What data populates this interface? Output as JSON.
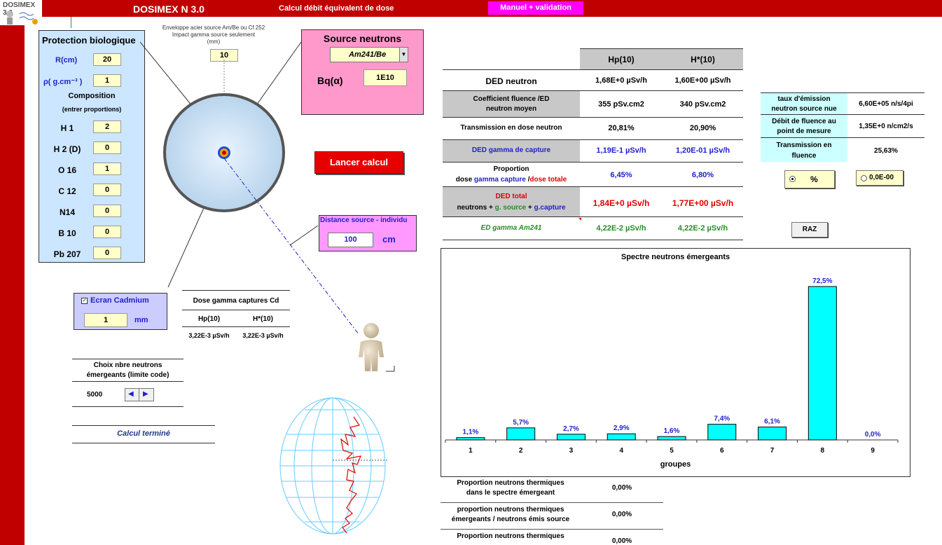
{
  "app": {
    "logo_text": "DOSIMEX 3.0",
    "title": "DOSIMEX N 3.0",
    "subtitle": "Calcul débit équivalent de dose",
    "manual_button": "Manuel + validation"
  },
  "protection": {
    "title": "Protection biologique",
    "r_label": "R(cm)",
    "r_value": "20",
    "rho_label": "ρ( g.cm⁻³ )",
    "rho_value": "1",
    "composition_title": "Composition",
    "composition_hint": "(entrer proportions)",
    "elements": [
      {
        "label": "H 1",
        "value": "2"
      },
      {
        "label": "H 2 (D)",
        "value": "0"
      },
      {
        "label": "O 16",
        "value": "1"
      },
      {
        "label": "C 12",
        "value": "0"
      },
      {
        "label": "N14",
        "value": "0"
      },
      {
        "label": "B 10",
        "value": "0"
      },
      {
        "label": "Pb 207",
        "value": "0"
      }
    ]
  },
  "envelope": {
    "line1": "Enveloppe acier source Am/Be  ou Cf 252",
    "line2": "Impact gamma source seulement",
    "line3": "(mm)",
    "value": "10"
  },
  "source": {
    "title": "Source neutrons",
    "selected": "Am241/Be",
    "bq_label": "Bq(α)",
    "bq_value": "1E10"
  },
  "launch_button": "Lancer calcul",
  "distance": {
    "title": "Distance source - individu",
    "value": "100",
    "unit": "cm"
  },
  "cadmium": {
    "checked": true,
    "label": "Ecran Cadmium",
    "value": "1",
    "unit": "mm"
  },
  "gamma_cd": {
    "title": "Dose gamma captures Cd",
    "col1": "Hp(10)",
    "col2": "H*(10)",
    "val1": "3,22E-3 µSv/h",
    "val2": "3,22E-3 µSv/h"
  },
  "neutron_choice": {
    "title1": "Choix nbre neutrons",
    "title2": "émergeants (limite code)",
    "value": "5000"
  },
  "status": "Calcul terminé",
  "results": {
    "col1": "Hp(10)",
    "col2": "H*(10)",
    "ded_neutron": {
      "label": "DED neutron",
      "v1": "1,68E+0 µSv/h",
      "v2": "1,60E+00 µSv/h"
    },
    "coef": {
      "label1": "Coefficient  fluence /ED",
      "label2": "neutron moyen",
      "v1": "355 pSv.cm2",
      "v2": "340 pSv.cm2"
    },
    "transmission": {
      "label": "Transmission en dose neutron",
      "v1": "20,81%",
      "v2": "20,90%"
    },
    "gamma_capture": {
      "label": "DED gamma de capture",
      "v1": "1,19E-1 µSv/h",
      "v2": "1,20E-01 µSv/h"
    },
    "proportion": {
      "label1": "Proportion",
      "label2a": "dose ",
      "label2b": "gamma capture",
      "label2c": " /",
      "label2d": "dose totale",
      "v1": "6,45%",
      "v2": "6,80%"
    },
    "total": {
      "label1": "DED total",
      "label2a": "neutrons + ",
      "label2b": "g. source",
      "label2c": " + ",
      "label2d": "g.capture",
      "v1": "1,84E+0 µSv/h",
      "v2": "1,77E+00 µSv/h"
    },
    "gamma_am": {
      "label": "ED gamma Am241",
      "v1": "4,22E-2 µSv/h",
      "v2": "4,22E-2 µSv/h"
    }
  },
  "emission": {
    "rate_label1": "taux d'émission",
    "rate_label2": "neutron source nue",
    "rate_value": "6,60E+05 n/s/4pi",
    "fluence_label1": "Débit de fluence au",
    "fluence_label2": "point de mesure",
    "fluence_value": "1,35E+0 n/cm2/s",
    "trans_label1": "Transmission en",
    "trans_label2": "fluence",
    "trans_value": "25,63%",
    "opt_percent": "%",
    "opt_value": "0,0E-00",
    "raz_button": "RAZ"
  },
  "thermal": [
    {
      "label1": "Proportion neutrons thermiques",
      "label2": "dans le spectre émergeant",
      "value": "0,00%"
    },
    {
      "label1": "proportion neutrons thermiques",
      "label2": "émergeants / neutrons émis source",
      "value": "0,00%"
    },
    {
      "label1": "Proportion neutrons thermiques",
      "label2": "",
      "value": "0,00%"
    }
  ],
  "chart_data": {
    "type": "bar",
    "title": "Spectre neutrons émergeants",
    "xlabel": "groupes",
    "ylabel": "",
    "categories": [
      "1",
      "2",
      "3",
      "4",
      "5",
      "6",
      "7",
      "8",
      "9"
    ],
    "values": [
      1.1,
      5.7,
      2.7,
      2.9,
      1.6,
      7.4,
      6.1,
      72.5,
      0.0
    ],
    "labels": [
      "1,1%",
      "5,7%",
      "2,7%",
      "2,9%",
      "1,6%",
      "7,4%",
      "6,1%",
      "72,5%",
      "0,0%"
    ],
    "ylim": [
      0,
      72.5
    ],
    "grid": false,
    "bar_color": "#00ffff"
  },
  "colors": {
    "brand_red": "#c00000",
    "panel_blue": "#cce6ff",
    "source_pink": "#ff99cc",
    "input_yellow": "#ffffcc"
  }
}
